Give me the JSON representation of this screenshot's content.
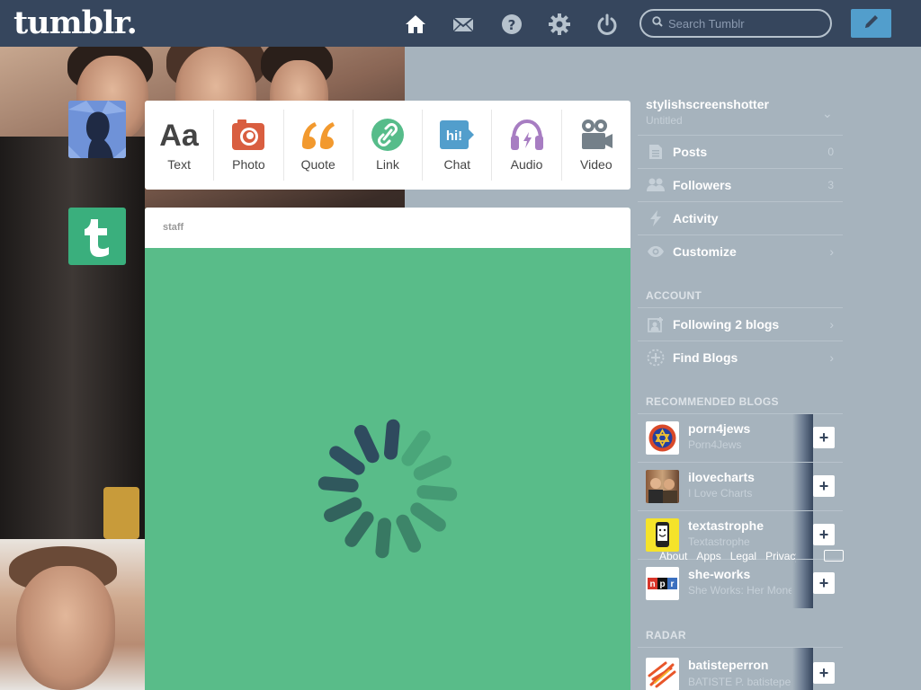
{
  "header": {
    "logo": "tumblr.",
    "search_placeholder": "Search Tumblr",
    "icons": [
      "home-icon",
      "mail-icon",
      "help-icon",
      "gear-icon",
      "power-icon"
    ]
  },
  "post_types": [
    {
      "label": "Text",
      "icon": "text-icon",
      "color": "#444444"
    },
    {
      "label": "Photo",
      "icon": "camera-icon",
      "color": "#d95e40"
    },
    {
      "label": "Quote",
      "icon": "quote-icon",
      "color": "#f2992e"
    },
    {
      "label": "Link",
      "icon": "link-icon",
      "color": "#56bc8a"
    },
    {
      "label": "Chat",
      "icon": "chat-icon",
      "color": "#529ecc"
    },
    {
      "label": "Audio",
      "icon": "headphones-icon",
      "color": "#a77dc2"
    },
    {
      "label": "Video",
      "icon": "video-camera-icon",
      "color": "#748089"
    }
  ],
  "post": {
    "author": "staff",
    "background": "#59bc89"
  },
  "sidebar": {
    "blog_name": "stylishscreenshotter",
    "blog_title": "Untitled",
    "items": [
      {
        "label": "Posts",
        "count": "0",
        "icon": "posts-icon"
      },
      {
        "label": "Followers",
        "count": "3",
        "icon": "followers-icon"
      },
      {
        "label": "Activity",
        "count": "",
        "icon": "lightning-icon"
      },
      {
        "label": "Customize",
        "count": "",
        "icon": "eye-icon"
      }
    ],
    "account_heading": "ACCOUNT",
    "account_items": [
      {
        "label": "Following 2 blogs",
        "icon": "following-icon"
      },
      {
        "label": "Find Blogs",
        "icon": "compass-icon"
      }
    ],
    "recommended_heading": "RECOMMENDED BLOGS",
    "recommended": [
      {
        "name": "porn4jews",
        "subtitle": "Porn4Jews"
      },
      {
        "name": "ilovecharts",
        "subtitle": "I Love Charts"
      },
      {
        "name": "textastrophe",
        "subtitle": "Textastrophe"
      },
      {
        "name": "she-works",
        "subtitle": "She Works: Her Money"
      }
    ],
    "footer_links": [
      "About",
      "Apps",
      "Legal",
      "Privacy"
    ],
    "radar_heading": "RADAR",
    "radar": [
      {
        "name": "batisteperron",
        "subtitle": "BATISTE P. batisteperron"
      }
    ]
  },
  "colors": {
    "header_bg": "#36465d",
    "page_bg": "#a6b3bd",
    "compose_bg": "#529ecc"
  }
}
